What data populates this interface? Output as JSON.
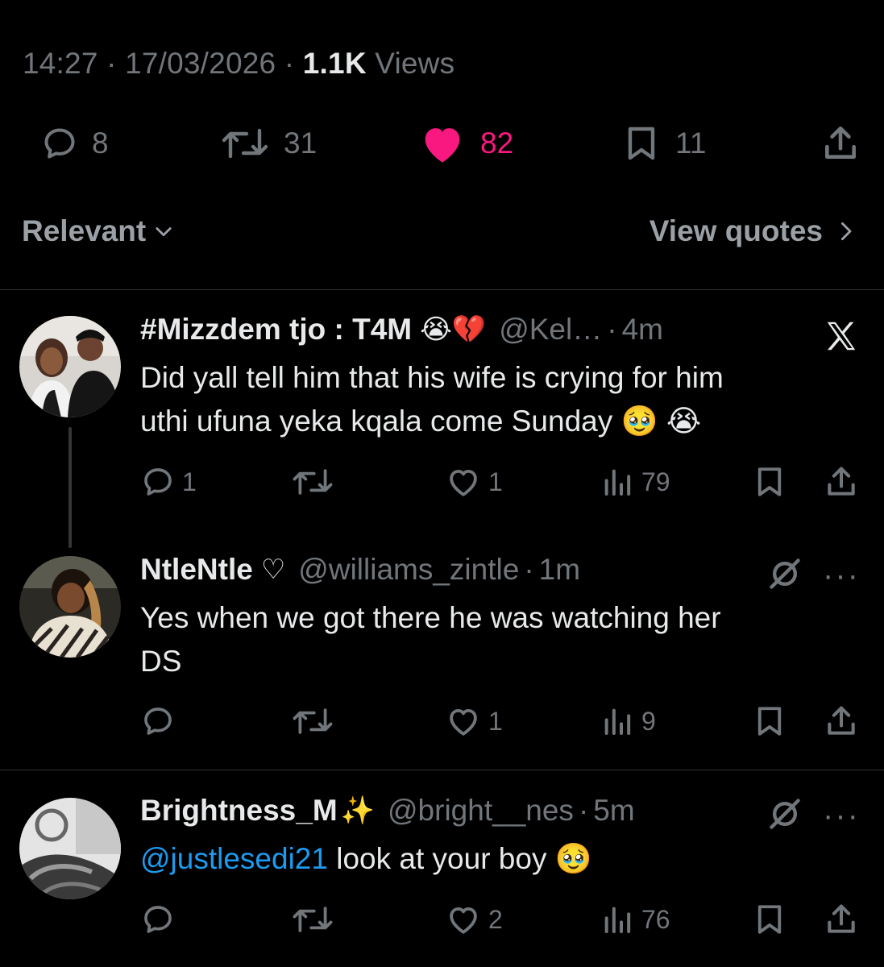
{
  "tweet_meta": {
    "time": "14:27",
    "date": "17/03/2026",
    "views_count": "1.1K",
    "views_label": "Views",
    "sep": "·"
  },
  "stats": {
    "replies": "8",
    "reposts": "31",
    "likes": "82",
    "bookmarks": "11",
    "like_color": "#f91880"
  },
  "sort": {
    "label": "Relevant",
    "view_quotes": "View quotes"
  },
  "replies": [
    {
      "name": "#Mizzdem tjo : T4M",
      "name_emoji": "😭💔",
      "handle": "@Kel…",
      "time": "4m",
      "line1": "Did yall tell him that his wife is crying for him",
      "line2": "uthi ufuna yeka kqala come Sunday 🥹 😭",
      "reply_count": "1",
      "like_count": "1",
      "view_count": "79"
    },
    {
      "name": "NtleNtle",
      "name_emoji": "♡",
      "handle": "@williams_zintle",
      "time": "1m",
      "line1": "Yes when we got there he was watching her",
      "line2": "DS",
      "like_count": "1",
      "view_count": "9"
    },
    {
      "name": "Brightness_M",
      "name_emoji": "✨",
      "handle": "@bright__nes",
      "time": "5m",
      "mention": "@justlesedi21",
      "text": " look at your boy 🥹",
      "like_count": "2",
      "view_count": "76"
    }
  ],
  "more_label": "···",
  "colors": {
    "accent": "#1d9bf0",
    "muted": "#71767b",
    "text": "#e7e9ea",
    "bg": "#000000"
  }
}
